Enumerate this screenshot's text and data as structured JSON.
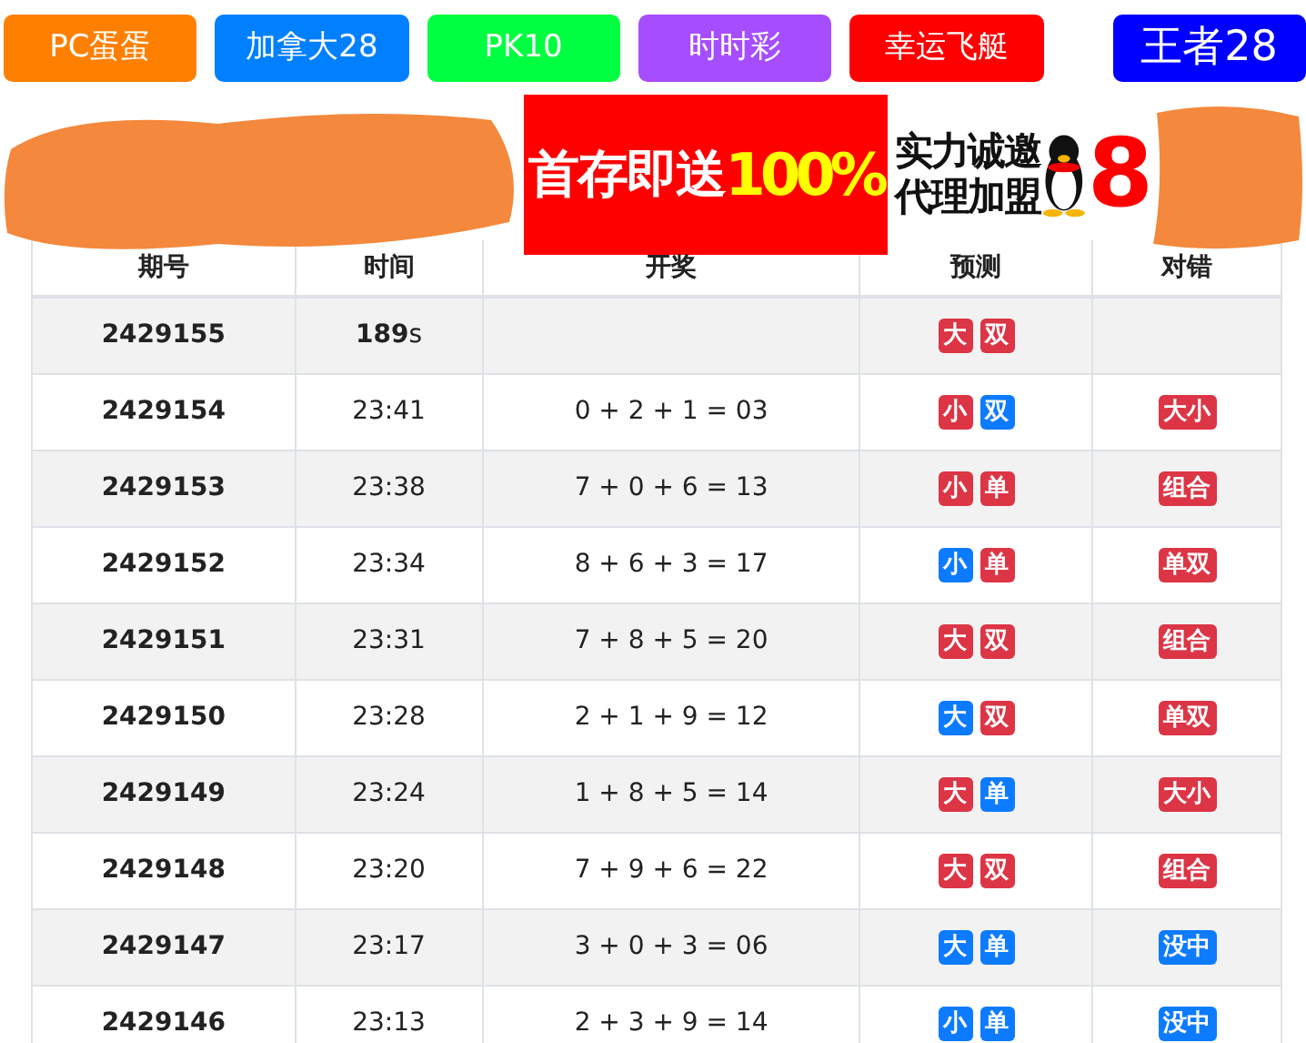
{
  "nav": [
    {
      "label": "PC蛋蛋",
      "color": "#ff8000",
      "selected": false
    },
    {
      "label": "加拿大28",
      "color": "#0080ff",
      "selected": false
    },
    {
      "label": "PK10",
      "color": "#00ff40",
      "selected": false
    },
    {
      "label": "时时彩",
      "color": "#a64dff",
      "selected": false
    },
    {
      "label": "幸运飞艇",
      "color": "#ff0000",
      "selected": false
    },
    {
      "label": "王者28",
      "color": "#0000ff",
      "selected": true
    }
  ],
  "banner": {
    "promo": "首存即送",
    "promo_figure": "100%",
    "invite_lines": [
      "实力诚邀",
      "代理加盟"
    ],
    "partial": "8"
  },
  "table": {
    "columns": [
      "期号",
      "时间",
      "开奖",
      "预测",
      "对错"
    ],
    "rows": [
      {
        "issue": "2429155",
        "time": "**189**s",
        "prediction": [
          {
            "text": "大",
            "color": "#dc3545"
          },
          {
            "text": "双",
            "color": "#dc3545"
          }
        ]
      },
      {
        "issue": "2429154",
        "time": "23:41",
        "result": "0 + 2 + 1 = 03",
        "prediction": [
          {
            "text": "小",
            "color": "#dc3545"
          },
          {
            "text": "双",
            "color": "#0d7bff"
          }
        ],
        "verdict": {
          "text": "大小",
          "color": "#dc3545"
        }
      },
      {
        "issue": "2429153",
        "time": "23:38",
        "result": "7 + 0 + 6 = 13",
        "prediction": [
          {
            "text": "小",
            "color": "#dc3545"
          },
          {
            "text": "单",
            "color": "#dc3545"
          }
        ],
        "verdict": {
          "text": "组合",
          "color": "#dc3545"
        }
      },
      {
        "issue": "2429152",
        "time": "23:34",
        "result": "8 + 6 + 3 = 17",
        "prediction": [
          {
            "text": "小",
            "color": "#0d7bff"
          },
          {
            "text": "单",
            "color": "#dc3545"
          }
        ],
        "verdict": {
          "text": "单双",
          "color": "#dc3545"
        }
      },
      {
        "issue": "2429151",
        "time": "23:31",
        "result": "7 + 8 + 5 = 20",
        "prediction": [
          {
            "text": "大",
            "color": "#dc3545"
          },
          {
            "text": "双",
            "color": "#dc3545"
          }
        ],
        "verdict": {
          "text": "组合",
          "color": "#dc3545"
        }
      },
      {
        "issue": "2429150",
        "time": "23:28",
        "result": "2 + 1 + 9 = 12",
        "prediction": [
          {
            "text": "大",
            "color": "#0d7bff"
          },
          {
            "text": "双",
            "color": "#dc3545"
          }
        ],
        "verdict": {
          "text": "单双",
          "color": "#dc3545"
        }
      },
      {
        "issue": "2429149",
        "time": "23:24",
        "result": "1 + 8 + 5 = 14",
        "prediction": [
          {
            "text": "大",
            "color": "#dc3545"
          },
          {
            "text": "单",
            "color": "#0d7bff"
          }
        ],
        "verdict": {
          "text": "大小",
          "color": "#dc3545"
        }
      },
      {
        "issue": "2429148",
        "time": "23:20",
        "result": "7 + 9 + 6 = 22",
        "prediction": [
          {
            "text": "大",
            "color": "#dc3545"
          },
          {
            "text": "双",
            "color": "#dc3545"
          }
        ],
        "verdict": {
          "text": "组合",
          "color": "#dc3545"
        }
      },
      {
        "issue": "2429147",
        "time": "23:17",
        "result": "3 + 0 + 3 = 06",
        "prediction": [
          {
            "text": "大",
            "color": "#0d7bff"
          },
          {
            "text": "单",
            "color": "#0d7bff"
          }
        ],
        "verdict": {
          "text": "没中",
          "color": "#0d7bff"
        }
      },
      {
        "issue": "2429146",
        "time": "23:13",
        "result": "2 + 3 + 9 = 14",
        "prediction": [
          {
            "text": "小",
            "color": "#0d7bff"
          },
          {
            "text": "单",
            "color": "#0d7bff"
          }
        ],
        "verdict": {
          "text": "没中",
          "color": "#0d7bff"
        }
      }
    ]
  }
}
